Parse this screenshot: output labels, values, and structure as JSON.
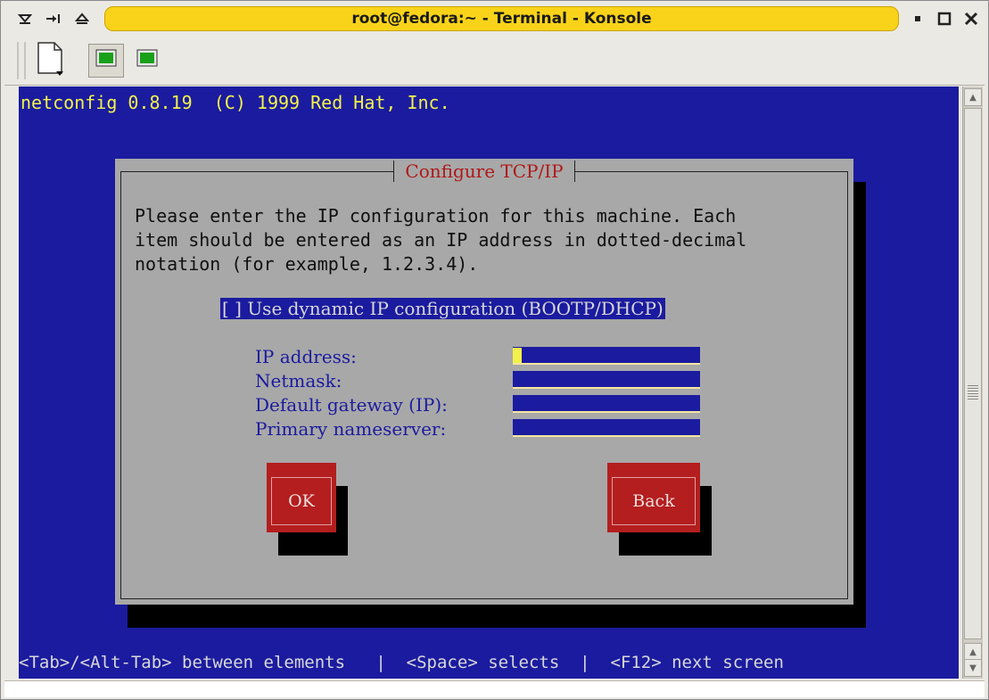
{
  "window": {
    "title": "root@fedora:~ - Terminal - Konsole"
  },
  "titlebar_icons": {
    "left": [
      "menu-icon",
      "sticky-icon",
      "shade-icon"
    ],
    "right": [
      "minimize-icon",
      "maximize-icon",
      "close-icon"
    ]
  },
  "terminal": {
    "header": "netconfig 0.8.19  (C) 1999 Red Hat, Inc.",
    "dialog": {
      "title": "Configure TCP/IP",
      "description_lines": [
        "Please enter the IP configuration for this machine. Each",
        "item should be entered as an IP address in dotted-decimal",
        "notation (for example, 1.2.3.4)."
      ],
      "dhcp_checkbox": "[ ] Use dynamic IP configuration (BOOTP/DHCP)",
      "fields": [
        {
          "label": "IP address:",
          "value": ""
        },
        {
          "label": "Netmask:",
          "value": ""
        },
        {
          "label": "Default gateway (IP):",
          "value": ""
        },
        {
          "label": "Primary nameserver:",
          "value": ""
        }
      ],
      "ok_label": "OK",
      "back_label": "Back"
    },
    "status_line": "<Tab>/<Alt-Tab> between elements   |  <Space> selects  |  <F12> next screen"
  },
  "colors": {
    "terminal_bg": "#1b1ba0",
    "dialog_bg": "#a8a8a8",
    "button_bg": "#b41e1e",
    "title_bar": "#f9d31a"
  }
}
